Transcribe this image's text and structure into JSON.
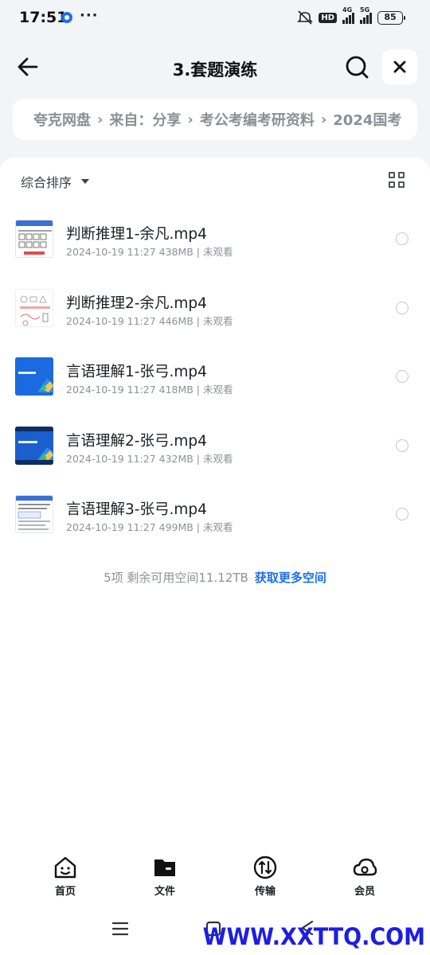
{
  "status_bar": {
    "time": "17:51",
    "dots": "···",
    "hd": "HD",
    "net1": "4G",
    "net2": "5G",
    "battery": "85",
    "icons": [
      "app-notification-icon",
      "mute-icon",
      "signal-icon",
      "battery-icon"
    ]
  },
  "header": {
    "title": "3.套题演练",
    "back_icon": "arrow-left-icon",
    "search_icon": "search-icon",
    "close_icon": "close-icon"
  },
  "breadcrumb": {
    "items": [
      "夸克网盘",
      "来自：分享",
      "考公考编考研资料",
      "2024国考"
    ],
    "separator": "›"
  },
  "toolbar": {
    "sort_label": "综合排序",
    "grid_icon": "grid-view-icon"
  },
  "files": [
    {
      "name": "判断推理1-余凡.mp4",
      "meta": "2024-10-19 11:27  438MB | 未观看",
      "thumb": "slide-light"
    },
    {
      "name": "判断推理2-余凡.mp4",
      "meta": "2024-10-19 11:27  446MB | 未观看",
      "thumb": "slide-sketch"
    },
    {
      "name": "言语理解1-张弓.mp4",
      "meta": "2024-10-19 11:27  418MB | 未观看",
      "thumb": "slide-blue"
    },
    {
      "name": "言语理解2-张弓.mp4",
      "meta": "2024-10-19 11:27  432MB | 未观看",
      "thumb": "slide-blue-dark"
    },
    {
      "name": "言语理解3-张弓.mp4",
      "meta": "2024-10-19 11:27  499MB | 未观看",
      "thumb": "slide-doc"
    }
  ],
  "footer": {
    "info": "5项 剩余可用空间11.12TB",
    "more_link": "获取更多空间"
  },
  "bottom_nav": [
    {
      "label": "首页",
      "icon": "home-face-icon"
    },
    {
      "label": "文件",
      "icon": "folder-icon"
    },
    {
      "label": "传输",
      "icon": "transfer-icon"
    },
    {
      "label": "会员",
      "icon": "cloud-icon"
    }
  ],
  "watermark": "WWW.XXTTQ.COM",
  "colors": {
    "accent": "#1f6ef2",
    "background": "#f3f4f6",
    "text_primary": "#1c1f24",
    "text_secondary": "#8d9198"
  }
}
